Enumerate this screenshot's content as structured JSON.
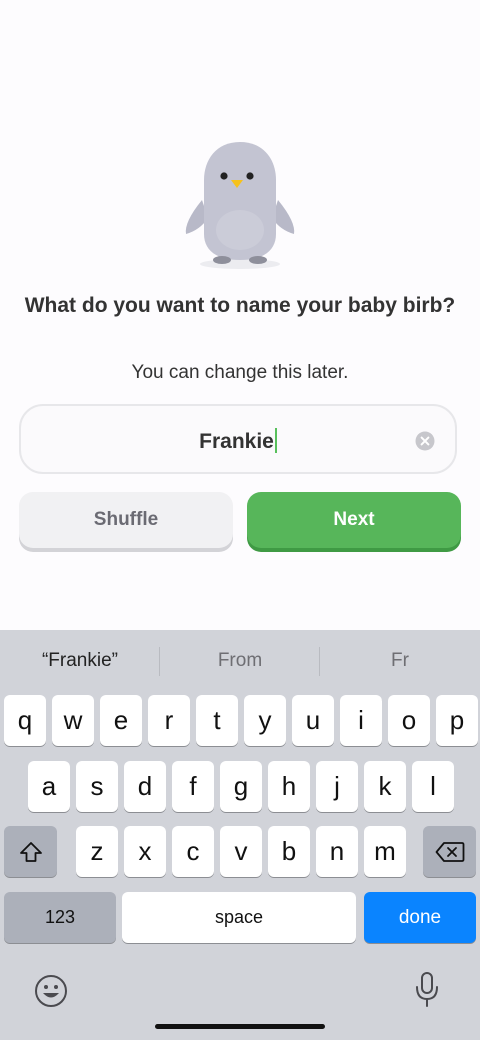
{
  "onboarding": {
    "title": "What do you want to name your baby birb?",
    "subtitle": "You can change this later.",
    "name_field": {
      "value": "Frankie"
    },
    "buttons": {
      "shuffle": "Shuffle",
      "next": "Next"
    }
  },
  "keyboard": {
    "suggestions": [
      "“Frankie”",
      "From",
      "Fr"
    ],
    "rows": [
      [
        "q",
        "w",
        "e",
        "r",
        "t",
        "y",
        "u",
        "i",
        "o",
        "p"
      ],
      [
        "a",
        "s",
        "d",
        "f",
        "g",
        "h",
        "j",
        "k",
        "l"
      ],
      [
        "z",
        "x",
        "c",
        "v",
        "b",
        "n",
        "m"
      ]
    ],
    "numbers_label": "123",
    "space_label": "space",
    "done_label": "done",
    "icons": {
      "shift": "shift-arrow-icon",
      "backspace": "backspace-icon",
      "emoji": "emoji-icon",
      "dictation": "microphone-icon"
    }
  },
  "colors": {
    "accent": "#57b65a",
    "done_key": "#0a84ff",
    "cursor": "#58c05c",
    "keyboard_bg": "#d1d3d9"
  }
}
